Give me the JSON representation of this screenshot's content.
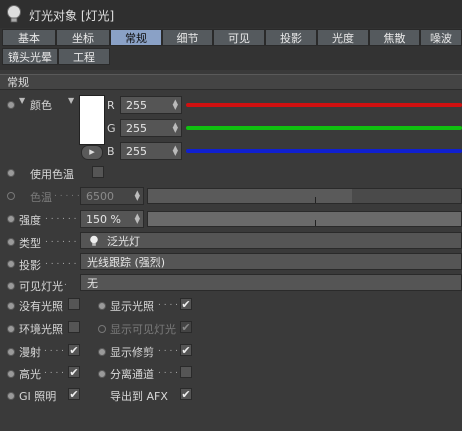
{
  "window": {
    "title": "灯光对象 [灯光]"
  },
  "tabs": {
    "row1": [
      "基本",
      "坐标",
      "常规",
      "细节",
      "可见",
      "投影",
      "光度",
      "焦散",
      "噪波"
    ],
    "row2": [
      "镜头光晕",
      "工程"
    ],
    "active": "常规"
  },
  "section": {
    "title": "常规"
  },
  "color": {
    "label": "颜色",
    "r_label": "R",
    "g_label": "G",
    "b_label": "B",
    "r": "255",
    "g": "255",
    "b": "255",
    "swatch": "#ffffff",
    "bar_colors": {
      "r": "#d01010",
      "g": "#10c010",
      "b": "#1020d0"
    }
  },
  "use_temperature": {
    "label": "使用色温"
  },
  "temperature": {
    "label": "色温",
    "value": "6500"
  },
  "intensity": {
    "label": "强度",
    "value": "150 %",
    "fill_fraction": 1.0
  },
  "type": {
    "label": "类型",
    "value": "泛光灯"
  },
  "shadow": {
    "label": "投影",
    "value": "光线跟踪 (强烈)"
  },
  "visible_light": {
    "label": "可见灯光",
    "value": "无"
  },
  "checkboxes": {
    "no_illumination": {
      "label": "没有光照",
      "checked": false
    },
    "show_illumination": {
      "label": "显示光照",
      "checked": true
    },
    "ambient_illumination": {
      "label": "环境光照",
      "checked": false
    },
    "show_visible_light": {
      "label": "显示可见灯光",
      "checked": true
    },
    "diffuse": {
      "label": "漫射",
      "checked": true
    },
    "show_clipping": {
      "label": "显示修剪",
      "checked": true
    },
    "specular": {
      "label": "高光",
      "checked": true
    },
    "separate_pass": {
      "label": "分离通道",
      "checked": false
    },
    "gi_illumination": {
      "label": "GI 照明",
      "checked": true
    },
    "export_afx": {
      "label": "导出到 AFX",
      "checked": true
    }
  },
  "glyphs": {
    "check": "✔",
    "dots": ". . . . . .",
    "spin_up": "▲",
    "spin_down": "▼",
    "expand": "▼",
    "play": "▸"
  }
}
